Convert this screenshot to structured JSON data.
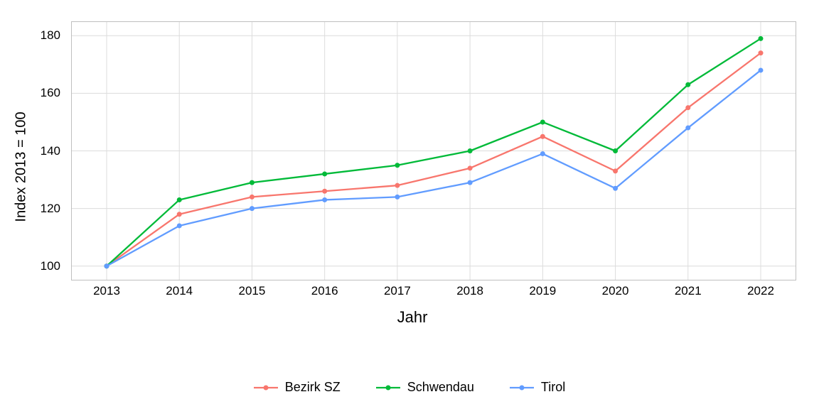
{
  "chart_data": {
    "type": "line",
    "title": "",
    "xlabel": "Jahr",
    "ylabel": "Index  2013  = 100",
    "x_ticks": [
      "2013",
      "2014",
      "2015",
      "2016",
      "2017",
      "2018",
      "2019",
      "2020",
      "2021",
      "2022"
    ],
    "y_ticks": [
      100,
      120,
      140,
      160,
      180
    ],
    "ylim": [
      95,
      185
    ],
    "legend_position": "bottom",
    "categories": [
      2013,
      2014,
      2015,
      2016,
      2017,
      2018,
      2019,
      2020,
      2021,
      2022
    ],
    "series": [
      {
        "name": "Bezirk SZ",
        "color": "#f8766d",
        "values": [
          100,
          118,
          124,
          126,
          128,
          134,
          145,
          133,
          155,
          174
        ]
      },
      {
        "name": "Schwendau",
        "color": "#00ba38",
        "values": [
          100,
          123,
          129,
          132,
          135,
          140,
          150,
          140,
          163,
          179
        ]
      },
      {
        "name": "Tirol",
        "color": "#619cff",
        "values": [
          100,
          114,
          120,
          123,
          124,
          129,
          139,
          127,
          148,
          168
        ]
      }
    ]
  }
}
